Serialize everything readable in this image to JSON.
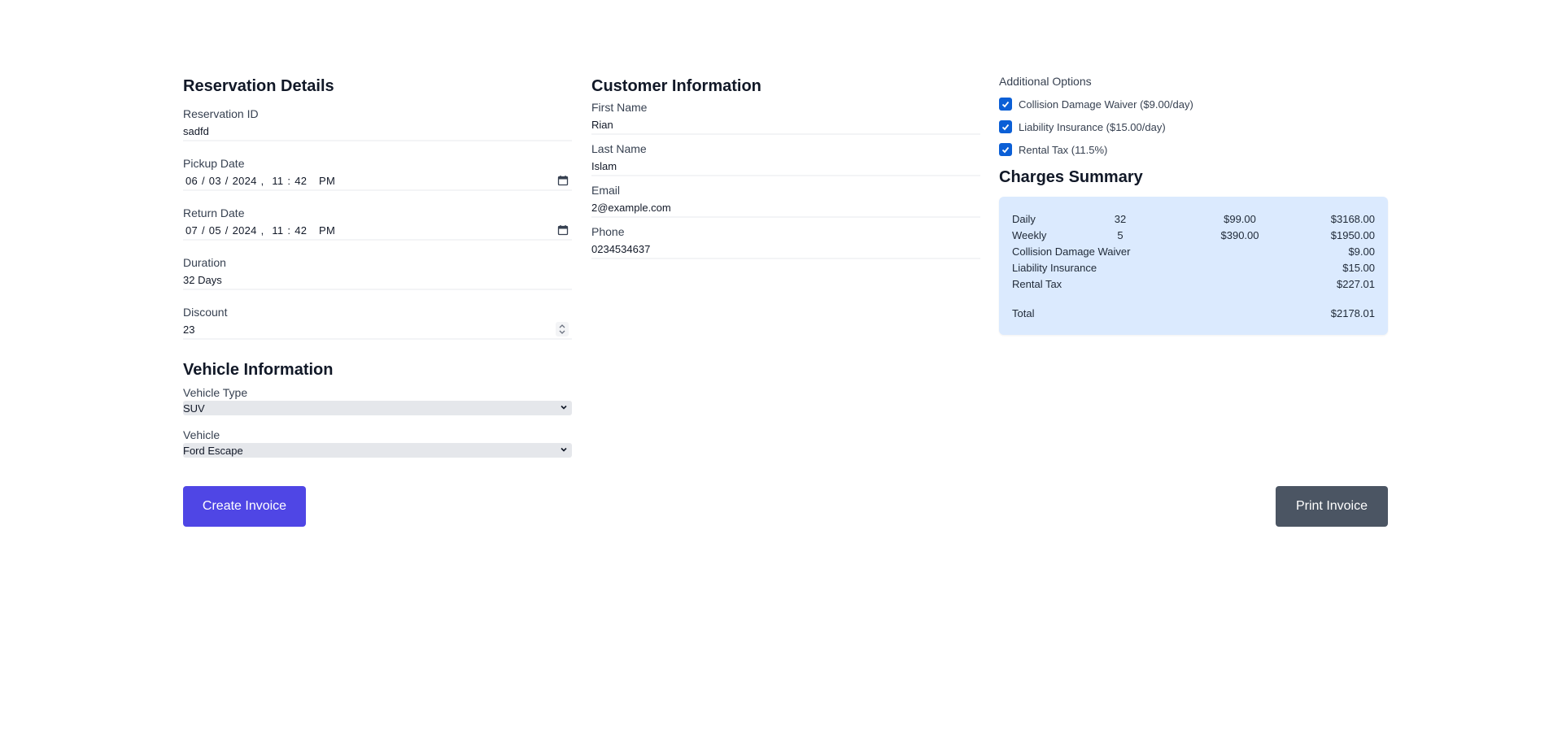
{
  "reservation": {
    "title": "Reservation Details",
    "id_label": "Reservation ID",
    "id_value": "sadfd",
    "pickup_label": "Pickup Date",
    "pickup_value": "06 / 03 / 2024 ,  11 : 42   PM",
    "return_label": "Return Date",
    "return_value": "07 / 05 / 2024 ,  11 : 42   PM",
    "duration_label": "Duration",
    "duration_value": "32 Days",
    "discount_label": "Discount",
    "discount_value": "23"
  },
  "vehicle": {
    "title": "Vehicle Information",
    "type_label": "Vehicle Type",
    "type_value": "SUV",
    "vehicle_label": "Vehicle",
    "vehicle_value": "Ford Escape"
  },
  "customer": {
    "title": "Customer Information",
    "first_label": "First Name",
    "first_value": "Rian",
    "last_label": "Last Name",
    "last_value": "Islam",
    "email_label": "Email",
    "email_value": "2@example.com",
    "phone_label": "Phone",
    "phone_value": "0234534637"
  },
  "options": {
    "title": "Additional Options",
    "items": [
      {
        "label": "Collision Damage Waiver ($9.00/day)",
        "checked": true
      },
      {
        "label": "Liability Insurance ($15.00/day)",
        "checked": true
      },
      {
        "label": "Rental Tax (11.5%)",
        "checked": true
      }
    ]
  },
  "summary": {
    "title": "Charges Summary",
    "rows": [
      {
        "name": "Daily",
        "qty": "32",
        "rate": "$99.00",
        "amount": "$3168.00"
      },
      {
        "name": "Weekly",
        "qty": "5",
        "rate": "$390.00",
        "amount": "$1950.00"
      },
      {
        "name": "Collision Damage Waiver",
        "qty": "",
        "rate": "",
        "amount": "$9.00"
      },
      {
        "name": "Liability Insurance",
        "qty": "",
        "rate": "",
        "amount": "$15.00"
      },
      {
        "name": "Rental Tax",
        "qty": "",
        "rate": "",
        "amount": "$227.01"
      }
    ],
    "total_label": "Total",
    "total_value": "$2178.01"
  },
  "actions": {
    "create_label": "Create Invoice",
    "print_label": "Print Invoice"
  },
  "colors": {
    "primary": "#4f46e5",
    "secondary": "#4b5563",
    "summary_bg": "#dbeafe",
    "checkbox": "#0b5fd6"
  }
}
